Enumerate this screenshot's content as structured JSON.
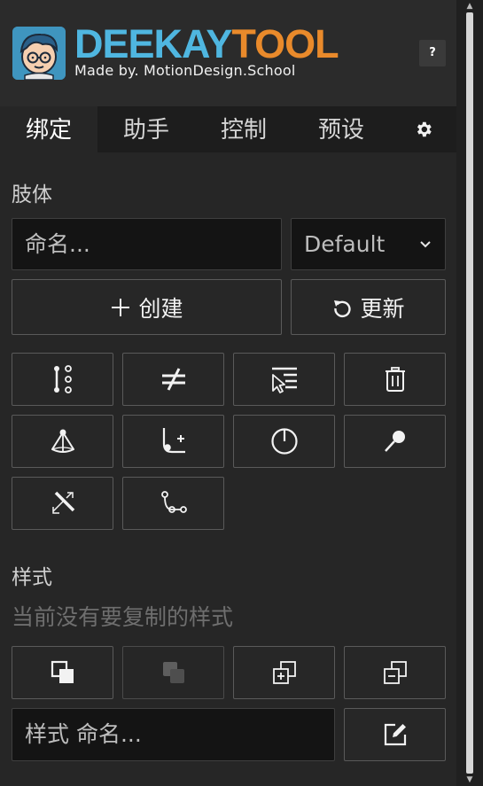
{
  "header": {
    "logo_left": "DEEKAY",
    "logo_right": "TOOL",
    "subtitle": "Made by. MotionDesign.School",
    "help_label": "?"
  },
  "tabs": [
    {
      "label": "绑定",
      "active": true
    },
    {
      "label": "助手",
      "active": false
    },
    {
      "label": "控制",
      "active": false
    },
    {
      "label": "预设",
      "active": false
    }
  ],
  "limb": {
    "title": "肢体",
    "name_placeholder": "命名...",
    "preset_select": "Default",
    "create_label": "创建",
    "update_label": "更新",
    "tools": [
      {
        "icon": "bone-chain-icon"
      },
      {
        "icon": "not-equal-icon"
      },
      {
        "icon": "select-layers-icon"
      },
      {
        "icon": "trash-icon"
      },
      {
        "icon": "cone-icon"
      },
      {
        "icon": "add-joint-icon"
      },
      {
        "icon": "dial-icon"
      },
      {
        "icon": "pin-icon"
      },
      {
        "icon": "stretch-icon"
      },
      {
        "icon": "bezier-path-icon"
      }
    ]
  },
  "style": {
    "title": "样式",
    "empty_message": "当前没有要复制的样式",
    "name_placeholder": "样式 命名...",
    "buttons": [
      {
        "icon": "copy-style-icon",
        "enabled": true
      },
      {
        "icon": "paste-style-icon",
        "enabled": false
      },
      {
        "icon": "add-style-icon",
        "enabled": true
      },
      {
        "icon": "remove-style-icon",
        "enabled": true
      }
    ],
    "edit_icon": "edit-icon"
  },
  "colors": {
    "logo_blue": "#4fb6e0",
    "logo_orange": "#e98a2b",
    "panel_bg": "#262626",
    "tab_bar_bg": "#1d1d1d"
  }
}
